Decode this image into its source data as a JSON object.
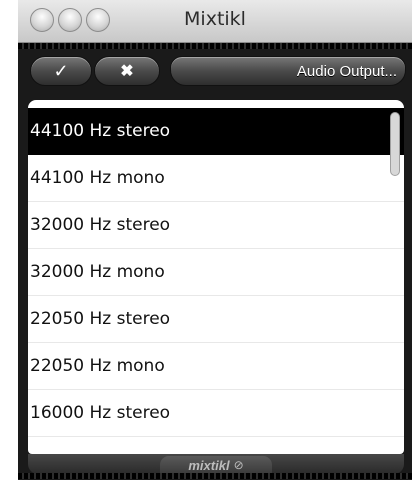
{
  "window": {
    "title": "Mixtikl"
  },
  "toolbar": {
    "ok_icon": "✓",
    "cancel_icon": "✖",
    "output_label": "Audio Output..."
  },
  "list": {
    "items": [
      {
        "label": "44100 Hz stereo",
        "selected": true
      },
      {
        "label": "44100 Hz mono"
      },
      {
        "label": "32000 Hz stereo"
      },
      {
        "label": "32000 Hz mono"
      },
      {
        "label": "22050 Hz stereo"
      },
      {
        "label": "22050 Hz mono"
      },
      {
        "label": "16000 Hz stereo"
      },
      {
        "label": ""
      }
    ]
  },
  "footer": {
    "brand": "mixtikl",
    "brand_icon": "⊘"
  }
}
